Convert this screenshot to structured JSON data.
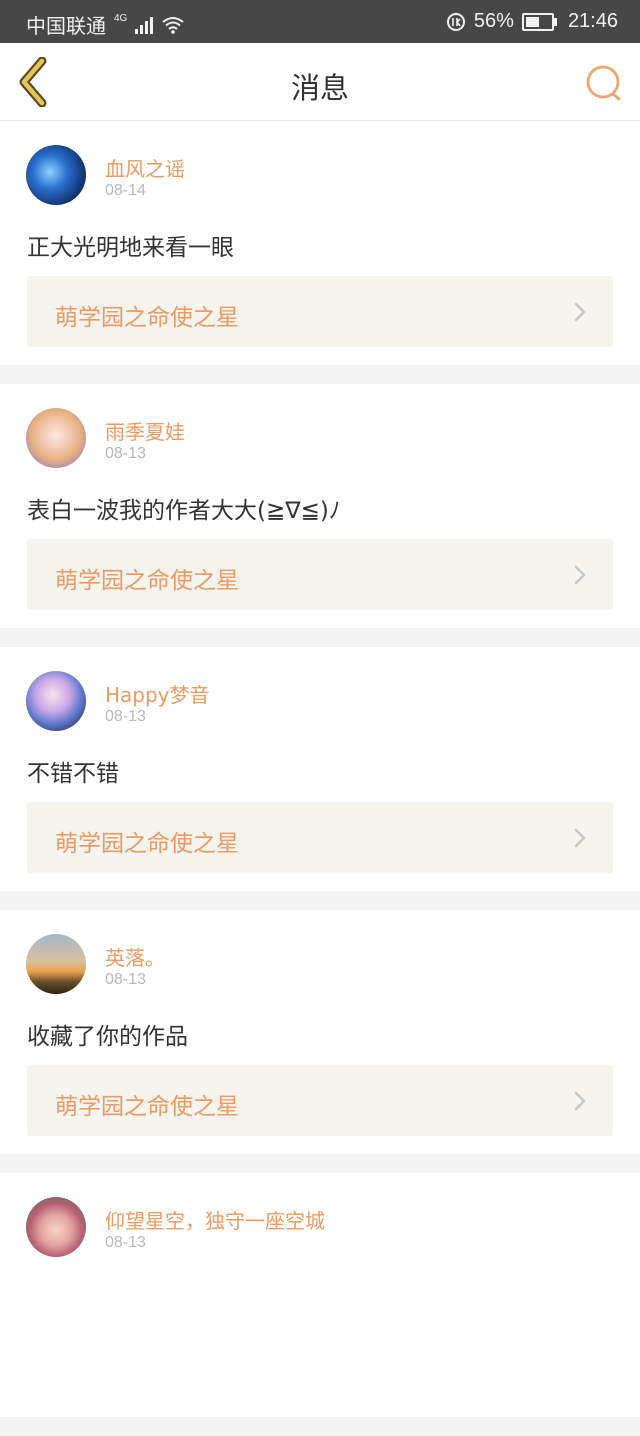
{
  "status_bar": {
    "carrier": "中国联通",
    "network": "4G",
    "battery_text": "56%",
    "battery_level": 0.56,
    "time": "21:46"
  },
  "header": {
    "title": "消息"
  },
  "colors": {
    "accent": "#ef9a63",
    "back_icon": "#d9b64c",
    "card_bg": "#f5f4ef"
  },
  "messages": [
    {
      "name": "血风之谣",
      "date": "08-14",
      "text": "正大光明地来看一眼",
      "work": "萌学园之命使之星"
    },
    {
      "name": "雨季夏娃",
      "date": "08-13",
      "text": "表白一波我的作者大大(≧∇≦)ﾉ",
      "work": "萌学园之命使之星"
    },
    {
      "name": "Happy梦音",
      "date": "08-13",
      "text": "不错不错",
      "work": "萌学园之命使之星"
    },
    {
      "name": "英落。",
      "date": "08-13",
      "text": "收藏了你的作品",
      "work": "萌学园之命使之星"
    },
    {
      "name": "仰望星空，独守一座空城",
      "date": "08-13",
      "text": "",
      "work": ""
    }
  ]
}
